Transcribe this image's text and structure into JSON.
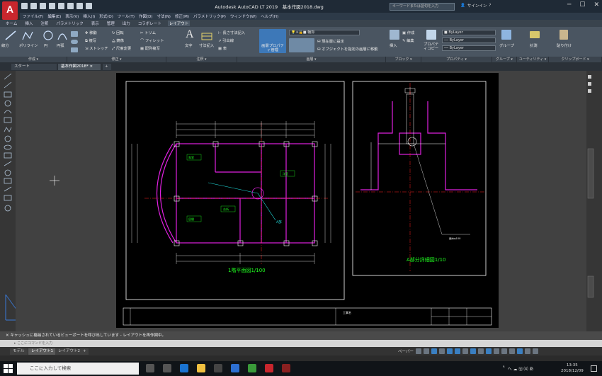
{
  "app": {
    "logo_letter": "A",
    "window_title": "Autodesk AutoCAD LT 2019　基本作図2018.dwg",
    "search_placeholder": "キーワードまたは語句を入力",
    "signin": "サインイン",
    "help": "?"
  },
  "menu": [
    "ファイル(F)",
    "編集(E)",
    "表示(V)",
    "挿入(I)",
    "形式(O)",
    "ツール(T)",
    "作図(D)",
    "寸法(N)",
    "修正(M)",
    "パラメトリック(P)",
    "ウィンドウ(W)",
    "ヘルプ(H)"
  ],
  "ribbon_tabs": [
    {
      "label": "ホーム",
      "active": false
    },
    {
      "label": "挿入",
      "active": false
    },
    {
      "label": "注釈",
      "active": false
    },
    {
      "label": "パラメトリック",
      "active": false
    },
    {
      "label": "表示",
      "active": false
    },
    {
      "label": "管理",
      "active": false
    },
    {
      "label": "出力",
      "active": false
    },
    {
      "label": "コラボレート",
      "active": false
    },
    {
      "label": "レイアウト",
      "active": true
    }
  ],
  "ribbon_tools": {
    "line": "線分",
    "polyline": "ポリライン",
    "circle": "円",
    "arc": "円弧",
    "move": "移動",
    "rotate": "回転",
    "trim": "トリム",
    "copy": "複写",
    "mirror": "鏡像",
    "fillet": "フィレット",
    "stretch": "ストレッチ",
    "scale": "尺度変更",
    "array": "配列複写",
    "text": "文字",
    "dimension": "寸法記入",
    "linear_dim": "長さ寸法記入",
    "leader": "引出線",
    "table": "表",
    "layer_props": "画層プロパティ管理",
    "layer_name": "輪郭",
    "make_current": "現在層に設定",
    "match_layer": "オブジェクトを指定の画層に移動",
    "insert": "挿入",
    "create": "作成",
    "edit": "編集",
    "properties_copy": "プロパティコピー",
    "bylayer1": "ByLayer",
    "bylayer2": "ByLayer",
    "bylayer3": "ByLayer",
    "group": "グループ",
    "measure": "計測",
    "paste": "貼り付け"
  },
  "panel_labels": [
    "作成 ▾",
    "修正 ▾",
    "注釈 ▾",
    "画層 ▾",
    "ブロック ▾",
    "プロパティ ▾",
    "グループ ▾",
    "ユーティリティ ▾",
    "クリップボード ▾"
  ],
  "doc_tabs": {
    "start": "スタート",
    "current": "基本作図2018*",
    "close": "×",
    "add": "+"
  },
  "drawing": {
    "plan_title": "1階平面図1/100",
    "detail_title": "A部分詳細図1/10",
    "room_japanese": "和室",
    "room_washitsu2": "洋室",
    "room_living": "居間",
    "room_kitchen": "台所",
    "room_corridor": "廊下",
    "marker_a": "A部",
    "detail_note": "面木φ100",
    "title_block_label": "工事名"
  },
  "command": {
    "history": "キャッシュに格納されているビューポートを呼び出しています - レイアウトを再作図中。",
    "placeholder": "ここにコマンドを入力"
  },
  "layout_tabs": [
    {
      "label": "モデル",
      "active": false
    },
    {
      "label": "レイアウト1",
      "active": true
    },
    {
      "label": "レイアウト2",
      "active": false
    }
  ],
  "status_bar": {
    "paper": "ペーパー"
  },
  "taskbar": {
    "search_placeholder": "ここに入力して検索",
    "tray_text": "へ ☁ 🖫 ⑷ あ",
    "time": "13:35",
    "date": "2018/12/09"
  },
  "colors": {
    "title_bg": "#1f2a36",
    "ribbon_bg": "#4a5561",
    "cad_magenta": "#e020e0",
    "cad_red": "#ff2020",
    "cad_green": "#20ff20",
    "cad_cyan": "#20e0e0",
    "cad_yellow": "#ffff40"
  }
}
